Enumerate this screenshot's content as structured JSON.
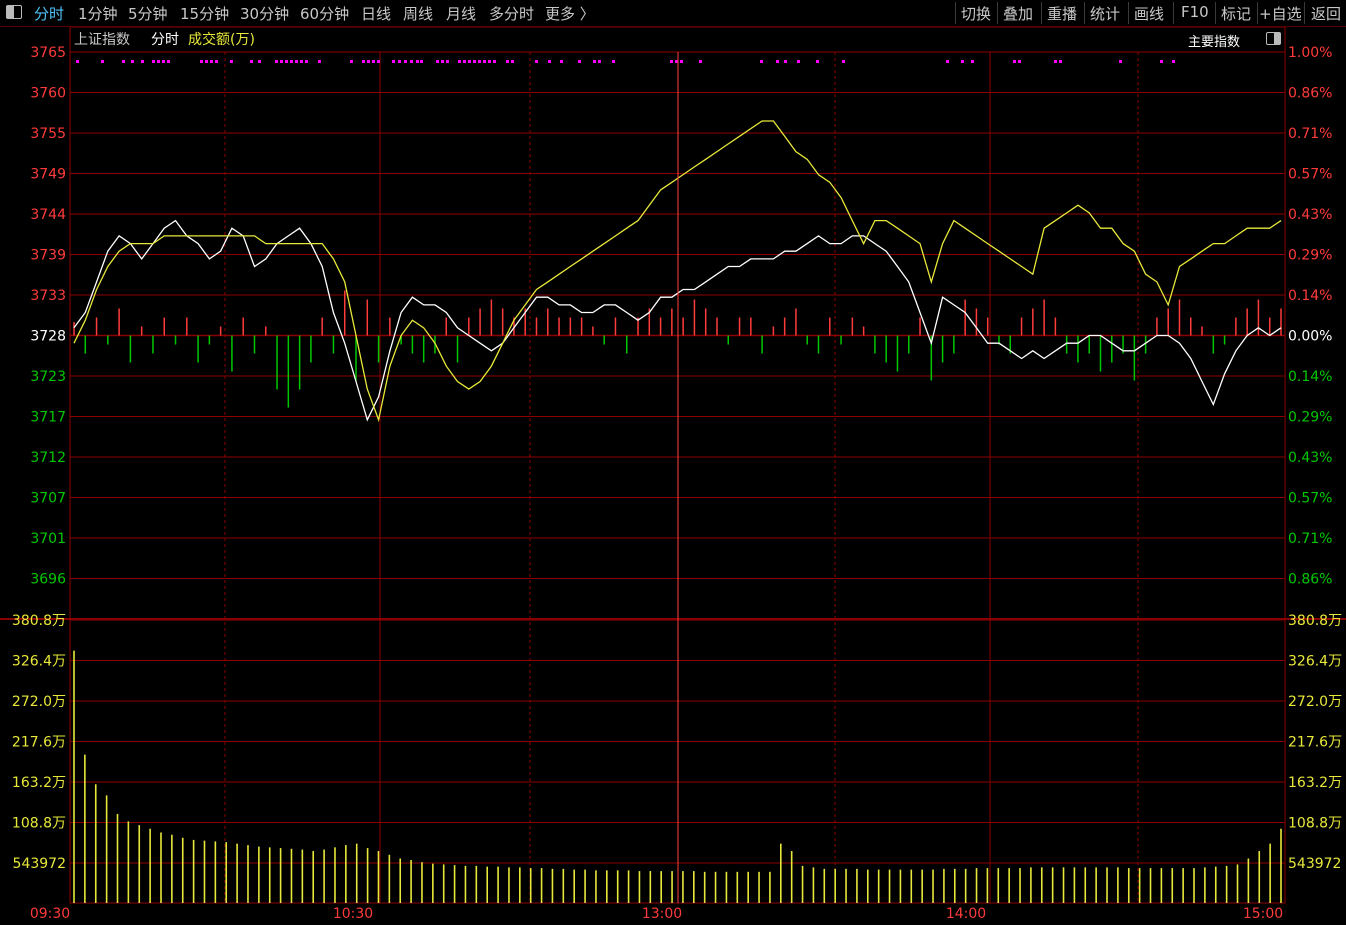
{
  "toolbar": {
    "left_items": [
      "分时",
      "1分钟",
      "5分钟",
      "15分钟",
      "30分钟",
      "60分钟",
      "日线",
      "周线",
      "月线",
      "多分时",
      "更多 〉"
    ],
    "active_index": 0,
    "right_items": [
      "切换",
      "叠加",
      "重播",
      "统计",
      "画线",
      "F10",
      "+自选",
      "返回"
    ],
    "mark_label": "标记"
  },
  "header": {
    "index_name": "上证指数",
    "mode": "分时",
    "volume_label": "成交额(万)",
    "right_title": "主要指数"
  },
  "colors": {
    "up": "#ff3b3b",
    "down": "#00c800",
    "grid": "#8b0000",
    "price_line": "#ffffff",
    "avg_line": "#e8e83a",
    "volume_bar": "#e8e83a",
    "marker": "#ff00ff",
    "active_tab": "#4fc3f7"
  },
  "chart_data": {
    "type": "line",
    "title": "上证指数 分时",
    "base_price": 3728,
    "y_tick_labels_left": [
      "3765",
      "3760",
      "3755",
      "3749",
      "3744",
      "3739",
      "3733",
      "3728",
      "3723",
      "3717",
      "3712",
      "3707",
      "3701",
      "3696"
    ],
    "y_tick_labels_right": [
      "1.00%",
      "0.86%",
      "0.71%",
      "0.57%",
      "0.43%",
      "0.29%",
      "0.14%",
      "0.00%",
      "0.14%",
      "0.29%",
      "0.43%",
      "0.57%",
      "0.71%",
      "0.86%"
    ],
    "ylim": [
      3691,
      3765
    ],
    "x_tick_labels": [
      "09:30",
      "10:30",
      "13:00",
      "14:00",
      "15:00"
    ],
    "series": [
      {
        "name": "price",
        "color": "#ffffff",
        "values": [
          3729,
          3731,
          3735,
          3739,
          3741,
          3740,
          3738,
          3740,
          3742,
          3743,
          3741,
          3740,
          3738,
          3739,
          3742,
          3741,
          3737,
          3738,
          3740,
          3741,
          3742,
          3740,
          3737,
          3731,
          3727,
          3722,
          3717,
          3720,
          3726,
          3731,
          3733,
          3732,
          3732,
          3731,
          3729,
          3728,
          3727,
          3726,
          3727,
          3729,
          3731,
          3733,
          3733,
          3732,
          3732,
          3731,
          3731,
          3732,
          3732,
          3731,
          3730,
          3731,
          3733,
          3733,
          3734,
          3734,
          3735,
          3736,
          3737,
          3737,
          3738,
          3738,
          3738,
          3739,
          3739,
          3740,
          3741,
          3740,
          3740,
          3741,
          3741,
          3740,
          3739,
          3737,
          3735,
          3731,
          3727,
          3733,
          3732,
          3731,
          3729,
          3727,
          3727,
          3726,
          3725,
          3726,
          3725,
          3726,
          3727,
          3727,
          3728,
          3728,
          3727,
          3726,
          3726,
          3727,
          3728,
          3728,
          3727,
          3725,
          3722,
          3719,
          3723,
          3726,
          3728,
          3729,
          3728,
          3729
        ],
        "x_start_minute": 0
      },
      {
        "name": "average",
        "color": "#e8e83a",
        "values": [
          3727,
          3730,
          3734,
          3737,
          3739,
          3740,
          3740,
          3740,
          3741,
          3741,
          3741,
          3741,
          3741,
          3741,
          3741,
          3741,
          3741,
          3740,
          3740,
          3740,
          3740,
          3740,
          3740,
          3738,
          3735,
          3728,
          3721,
          3717,
          3724,
          3728,
          3730,
          3729,
          3727,
          3724,
          3722,
          3721,
          3722,
          3724,
          3727,
          3730,
          3732,
          3734,
          3735,
          3736,
          3737,
          3738,
          3739,
          3740,
          3741,
          3742,
          3743,
          3745,
          3747,
          3748,
          3749,
          3750,
          3751,
          3752,
          3753,
          3754,
          3755,
          3756,
          3756,
          3754,
          3752,
          3751,
          3749,
          3748,
          3746,
          3743,
          3740,
          3743,
          3743,
          3742,
          3741,
          3740,
          3735,
          3740,
          3743,
          3742,
          3741,
          3740,
          3739,
          3738,
          3737,
          3736,
          3742,
          3743,
          3744,
          3745,
          3744,
          3742,
          3742,
          3740,
          3739,
          3736,
          3735,
          3732,
          3737,
          3738,
          3739,
          3740,
          3740,
          3741,
          3742,
          3742,
          3742,
          3743
        ]
      }
    ],
    "volume": {
      "ylabel": "成交额(万)",
      "tick_labels": [
        "380.8万",
        "326.4万",
        "272.0万",
        "217.6万",
        "163.2万",
        "108.8万",
        "543972"
      ],
      "ylim": [
        0,
        435.2
      ],
      "unit": "万",
      "values": [
        340,
        200,
        160,
        145,
        120,
        110,
        105,
        100,
        95,
        92,
        88,
        85,
        84,
        83,
        82,
        80,
        78,
        76,
        75,
        74,
        73,
        72,
        70,
        72,
        75,
        78,
        80,
        74,
        70,
        65,
        60,
        58,
        55,
        53,
        52,
        51,
        50,
        50,
        49,
        49,
        48,
        48,
        47,
        47,
        46,
        46,
        45,
        45,
        44,
        44,
        44,
        44,
        43,
        43,
        43,
        43,
        43,
        43,
        42,
        42,
        42,
        42,
        42,
        42,
        42,
        80,
        70,
        50,
        48,
        46,
        46,
        46,
        46,
        45,
        45,
        45,
        45,
        45,
        45,
        45,
        46,
        46,
        46,
        47,
        47,
        47,
        47,
        47,
        48,
        48,
        48,
        48,
        48,
        48,
        48,
        48,
        48,
        47,
        47,
        47,
        47,
        47,
        47,
        47,
        48,
        49,
        50,
        52,
        60,
        70,
        80,
        100
      ]
    },
    "diff_bars": {
      "values": [
        1.5,
        -2,
        2,
        -1,
        3,
        -3,
        1,
        -2,
        2,
        -1,
        2,
        -3,
        -1,
        1,
        -4,
        2,
        -2,
        1,
        -6,
        -8,
        -6,
        -3,
        2,
        -2,
        5,
        -5,
        4,
        -3,
        2,
        -1,
        -2,
        -3,
        -2,
        2,
        -3,
        2,
        3,
        4,
        3,
        2,
        3,
        2,
        3,
        2,
        2,
        2,
        1,
        -1,
        2,
        -2,
        2,
        3,
        2,
        3,
        2,
        4,
        3,
        2,
        -1,
        2,
        2,
        -2,
        1,
        2,
        3,
        -1,
        -2,
        2,
        -1,
        2,
        1,
        -2,
        -3,
        -4,
        -2,
        2,
        -5,
        -3,
        -2,
        4,
        3,
        2,
        -1,
        -2,
        2,
        3,
        4,
        2,
        -2,
        -3,
        -2,
        -4,
        -3,
        -2,
        -5,
        -2,
        2,
        3,
        4,
        2,
        1,
        -2,
        -1,
        2,
        3,
        4,
        2,
        3
      ],
      "up_color": "#ff3b3b",
      "down_color": "#00c800"
    },
    "grid": true
  }
}
